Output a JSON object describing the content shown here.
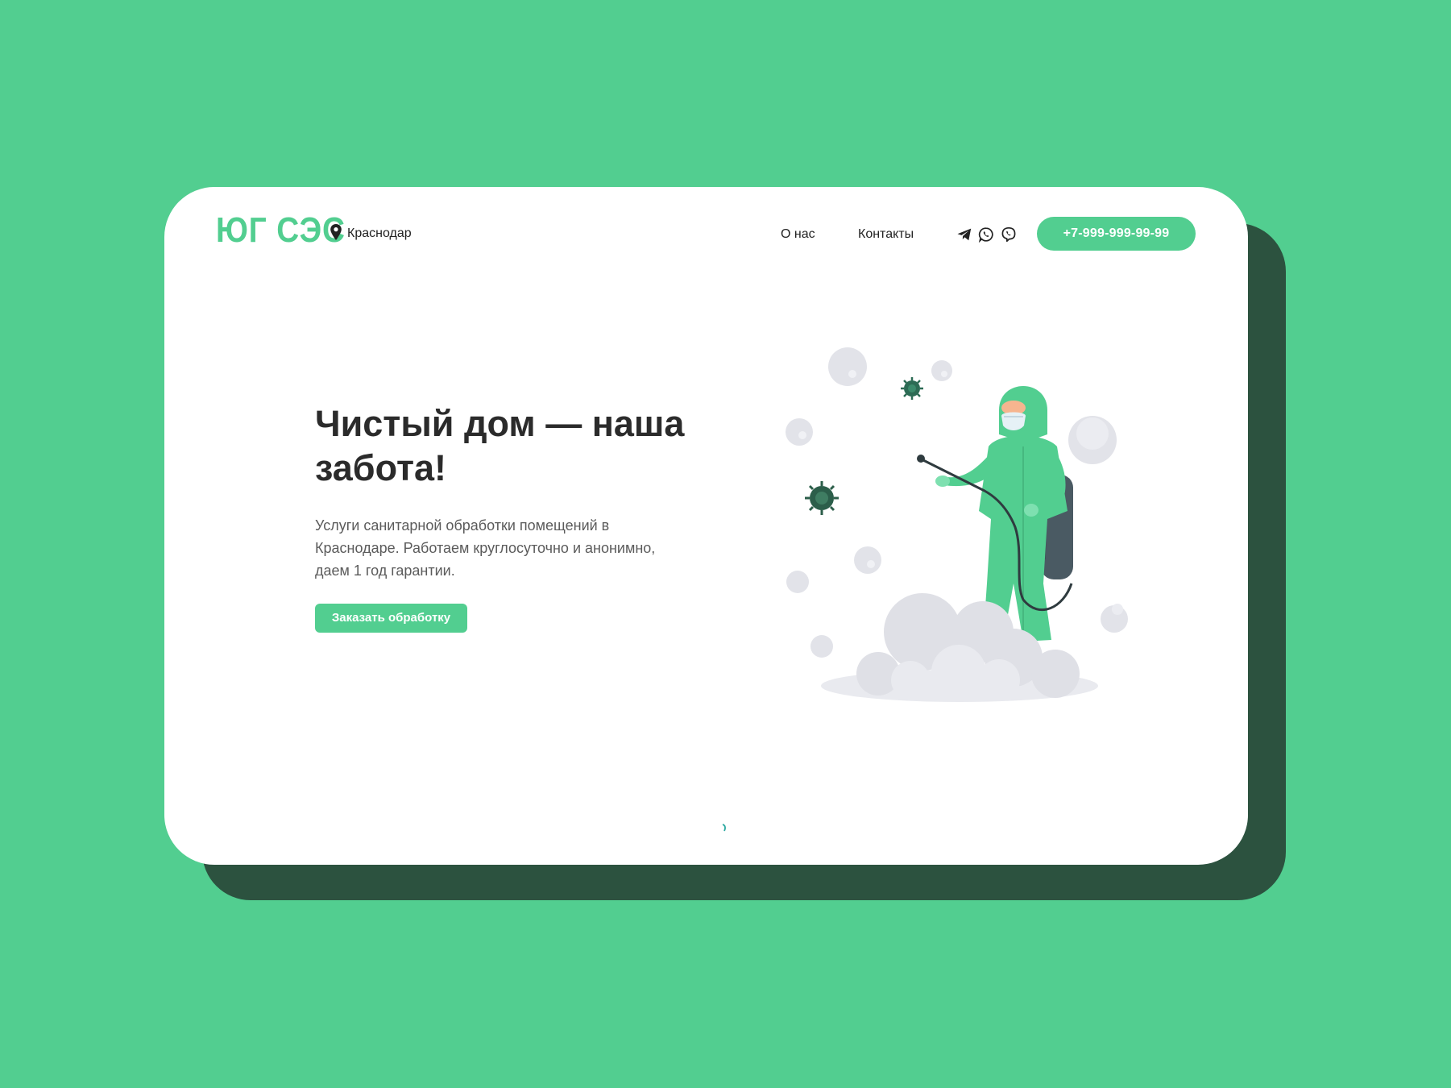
{
  "header": {
    "logo": "ЮГ СЭС",
    "city": "Краснодар",
    "nav": {
      "about": "О нас",
      "contacts": "Контакты"
    },
    "social_icons": [
      "telegram-icon",
      "whatsapp-icon",
      "viber-icon"
    ],
    "phone": "+7-999-999-99-99"
  },
  "hero": {
    "title": "Чистый дом — наша забота!",
    "description": "Услуги санитарной обработки помещений в Краснодаре. Работаем круглосуточно и анонимно, даем 1 год гарантии.",
    "cta": "Заказать обработку"
  },
  "colors": {
    "background": "#52ce90",
    "accent": "#52ce90",
    "card_shadow": "#2c523f",
    "card": "#ffffff",
    "title_text": "#2b2b2b",
    "body_text": "#5b5b5b"
  },
  "illustration": {
    "subject": "disinfector-in-protective-suit-icon"
  }
}
